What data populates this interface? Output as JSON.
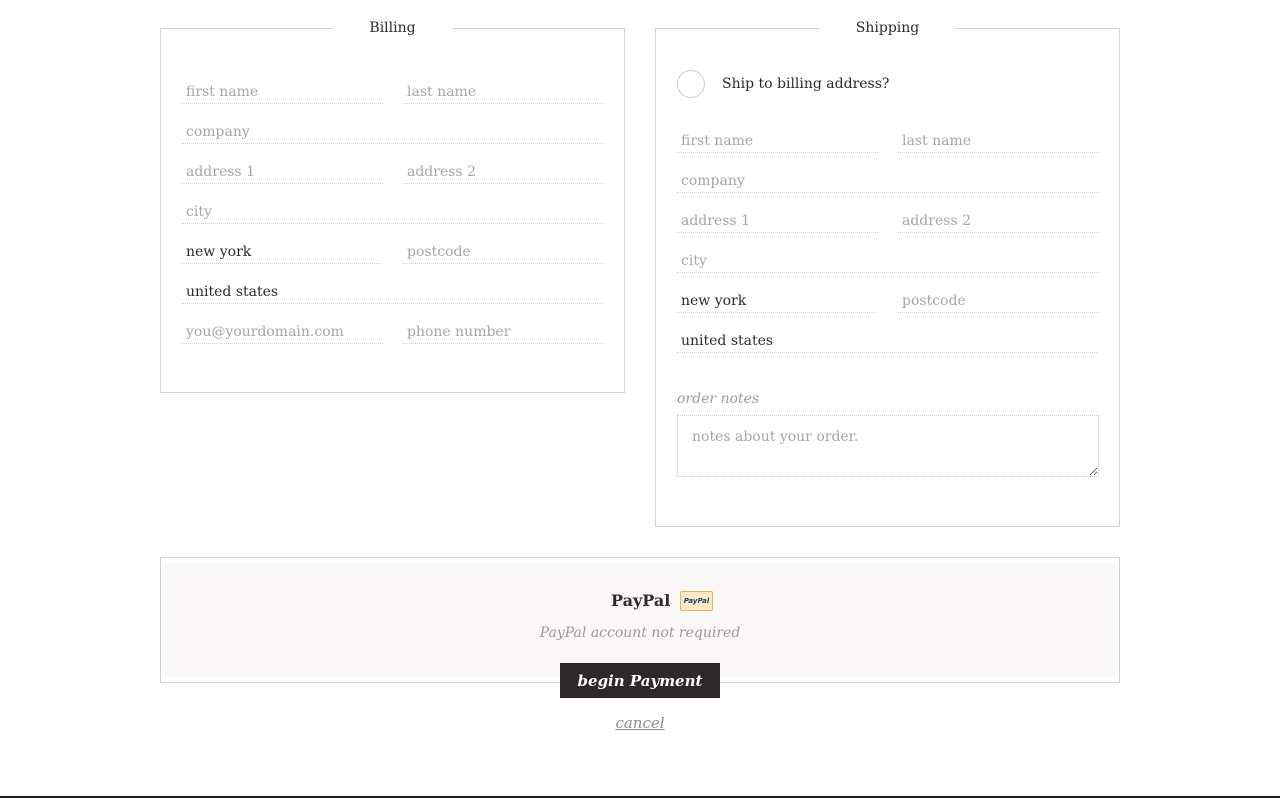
{
  "billing": {
    "legend": "Billing",
    "first_name_placeholder": "first name",
    "last_name_placeholder": "last name",
    "company_placeholder": "company",
    "address1_placeholder": "address 1",
    "address2_placeholder": "address 2",
    "city_placeholder": "city",
    "state_value": "new york",
    "postcode_placeholder": "postcode",
    "country_value": "united states",
    "email_placeholder": "you@yourdomain.com",
    "phone_placeholder": "phone number"
  },
  "shipping": {
    "legend": "Shipping",
    "ship_to_billing_label": "Ship to billing address?",
    "first_name_placeholder": "first name",
    "last_name_placeholder": "last name",
    "company_placeholder": "company",
    "address1_placeholder": "address 1",
    "address2_placeholder": "address 2",
    "city_placeholder": "city",
    "state_value": "new york",
    "postcode_placeholder": "postcode",
    "country_value": "united states",
    "order_notes_label": "order notes",
    "order_notes_placeholder": "notes about your order."
  },
  "payment": {
    "method_title": "PayPal",
    "logo_text": "PayPal",
    "note": "PayPal account not required",
    "begin_label": "begin Payment",
    "cancel_label": "cancel"
  }
}
